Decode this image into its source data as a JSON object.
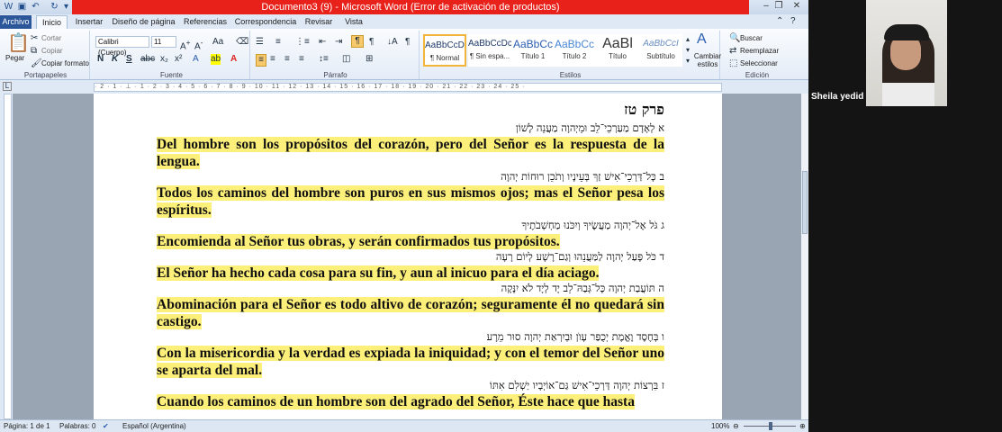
{
  "window": {
    "title": "Documento3 (9)  -  Microsoft Word (Error de activación de productos)"
  },
  "tabs": [
    "Archivo",
    "Inicio",
    "Insertar",
    "Diseño de página",
    "Referencias",
    "Correspondencia",
    "Revisar",
    "Vista"
  ],
  "ribbon": {
    "portapapeles": {
      "paste": "Pegar",
      "cut": "Cortar",
      "copy": "Copiar",
      "format_painter": "Copiar formato",
      "label": "Portapapeles"
    },
    "fuente": {
      "font_name": "Calibri (Cuerpo)",
      "font_size": "11",
      "label": "Fuente"
    },
    "parrafo": {
      "label": "Párrafo"
    },
    "estilos": {
      "items": [
        {
          "preview": "AaBbCcDc",
          "name": "¶ Normal"
        },
        {
          "preview": "AaBbCcDc",
          "name": "¶ Sin espa..."
        },
        {
          "preview": "AaBbCc",
          "name": "Título 1"
        },
        {
          "preview": "AaBbCc",
          "name": "Título 2"
        },
        {
          "preview": "AaBl",
          "name": "Título"
        },
        {
          "preview": "AaBbCcI",
          "name": "Subtítulo"
        }
      ],
      "change_styles": "Cambiar estilos",
      "label": "Estilos"
    },
    "edicion": {
      "find": "Buscar",
      "replace": "Reemplazar",
      "select": "Seleccionar",
      "label": "Edición"
    }
  },
  "ruler": "· 2 · 1 · ⊥ · 1 · 2 · 3 · 4 · 5 · 6 · 7 · 8 · 9 · 10 · 11 · 12 · 13 · 14 · 15 · 16 · 17 · 18 · 19 · 20 · 21 · 22 · 23 · 24 · 25 ·",
  "document": {
    "chapter_title": "פרק טז",
    "hebrew": [
      "א לְאָדָם מַעַרְכֵי־לֵב וּמֵיְהוָה מַעֲנֵה לָשׁוֹן",
      "ב כָּל־דַּרְכֵי־אִישׁ זַךְ בְּעֵינָיו וְתֹכֵן רוּחוֹת יְהוָה",
      "ג גֹּל אֶל־יְהוָה מַעֲשֶׂיךָ וְיִכֹּנוּ מַחְשְׁבֹתֶיךָ",
      "ד כֹּל פָּעַל יְהוָה לַמַּעֲנֵהוּ וְגַם־רָשָׁע לְיוֹם רָעָה",
      "ה תּוֹעֲבַת יְהוָה כָּל־גְּבַהּ־לֵב יָד לְיָד לֹא יִנָּקֶה",
      "ו בְּחֶסֶד וֶאֱמֶת יְכֻפַּר עָוֺן וּבְיִרְאַת יְהוָה סוּר מֵרָע",
      "ז בִּרְצוֹת יְהוָה דַּרְכֵי־אִישׁ גַּם־אוֹיְבָיו יַשְׁלִם אִתּוֹ"
    ],
    "spanish": [
      "Del hombre son los propósitos del corazón, pero del Señor es la respuesta de la lengua.",
      "Todos los caminos del hombre son puros en sus mismos ojos; mas el Señor pesa los espíritus.",
      "Encomienda al Señor tus obras, y serán confirmados tus propósitos.",
      "El Señor ha hecho cada cosa para su fin, y aun al inicuo para el día aciago.",
      "Abominación para el Señor es todo altivo de corazón; seguramente él no quedará sin castigo.",
      "Con la misericordia y la verdad es expiada la iniquidad; y con el temor del Señor uno se aparta del mal.",
      "Cuando los caminos de un hombre son del agrado del Señor, Éste hace que hasta"
    ]
  },
  "status": {
    "page": "Página: 1 de 1",
    "words": "Palabras: 0",
    "language": "Español (Argentina)",
    "zoom": "100%"
  },
  "participant": {
    "name": "Sheila yedid"
  },
  "colors": {
    "highlight": "#fdf07a",
    "title_bar_error": "#e8211a",
    "file_tab": "#2b579a"
  }
}
